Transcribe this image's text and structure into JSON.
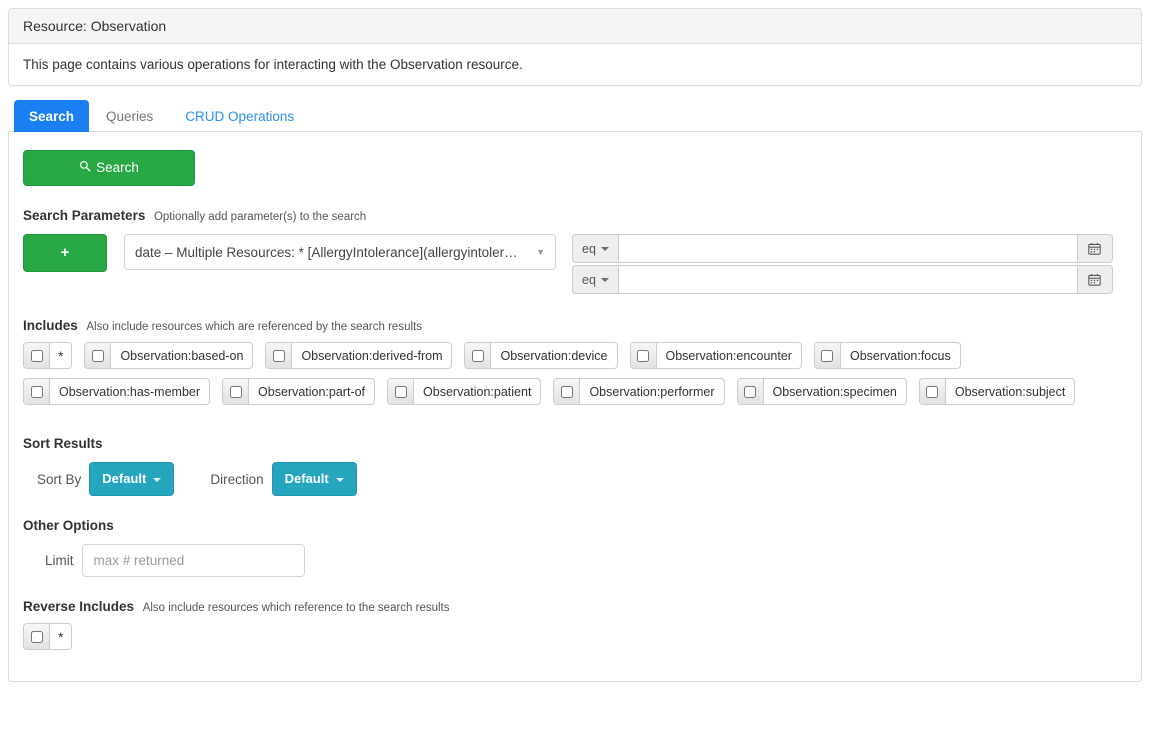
{
  "panel": {
    "heading": "Resource: Observation",
    "body": "This page contains various operations for interacting with the Observation resource."
  },
  "tabs": [
    {
      "label": "Search",
      "state": "active"
    },
    {
      "label": "Queries",
      "state": "inactive"
    },
    {
      "label": "CRUD Operations",
      "state": "link"
    }
  ],
  "search_button": {
    "label": "Search",
    "icon": "magnifier-icon",
    "color": "#27a844"
  },
  "search_parameters": {
    "title": "Search Parameters",
    "description": "Optionally add parameter(s) to the search",
    "add_button_label": "+",
    "selected_parameter": "date – Multiple Resources: * [AllergyIntolerance](allergyintoler…",
    "comparators": [
      {
        "label": "eq",
        "value": "",
        "calendar_icon": "calendar-icon"
      },
      {
        "label": "eq",
        "value": "",
        "calendar_icon": "calendar-icon"
      }
    ]
  },
  "includes": {
    "title": "Includes",
    "description": "Also include resources which are referenced by the search results",
    "items": [
      {
        "label": "*",
        "checked": false
      },
      {
        "label": "Observation:based-on",
        "checked": false
      },
      {
        "label": "Observation:derived-from",
        "checked": false
      },
      {
        "label": "Observation:device",
        "checked": false
      },
      {
        "label": "Observation:encounter",
        "checked": false
      },
      {
        "label": "Observation:focus",
        "checked": false
      },
      {
        "label": "Observation:has-member",
        "checked": false
      },
      {
        "label": "Observation:part-of",
        "checked": false
      },
      {
        "label": "Observation:patient",
        "checked": false
      },
      {
        "label": "Observation:performer",
        "checked": false
      },
      {
        "label": "Observation:specimen",
        "checked": false
      },
      {
        "label": "Observation:subject",
        "checked": false
      }
    ]
  },
  "sort_results": {
    "title": "Sort Results",
    "sort_by_label": "Sort By",
    "sort_by_value": "Default",
    "direction_label": "Direction",
    "direction_value": "Default",
    "accent_color": "#26a5bf"
  },
  "other_options": {
    "title": "Other Options",
    "limit_label": "Limit",
    "limit_value": "",
    "limit_placeholder": "max # returned"
  },
  "reverse_includes": {
    "title": "Reverse Includes",
    "description": "Also include resources which reference to the search results",
    "items": [
      {
        "label": "*",
        "checked": false
      }
    ]
  }
}
